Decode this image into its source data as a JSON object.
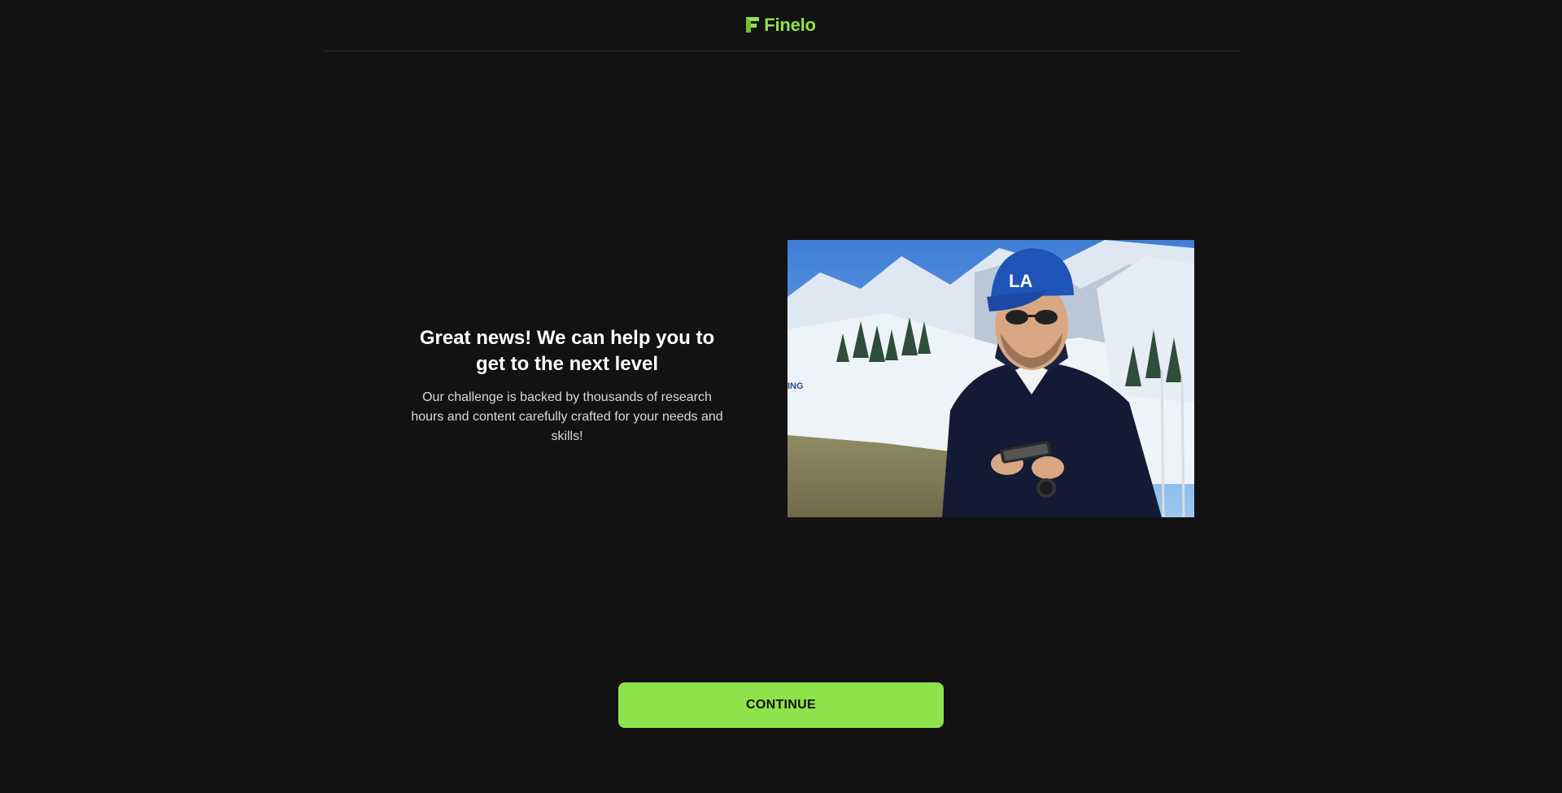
{
  "header": {
    "brand_name": "Finelo",
    "brand_color": "#8ee34a",
    "logo_icon": "finelo-f-logo-icon"
  },
  "main": {
    "headline": "Great news! We can help you to get to the next level",
    "description": "Our challenge is backed by thousands of research hours and content carefully crafted for your needs and skills!",
    "image": "man-in-blue-cap-using-phone-in-snowy-mountains-photo"
  },
  "footer": {
    "continue_label": "CONTINUE"
  },
  "colors": {
    "background": "#121212",
    "accent": "#8ee34a",
    "divider": "#2c2c2c"
  }
}
